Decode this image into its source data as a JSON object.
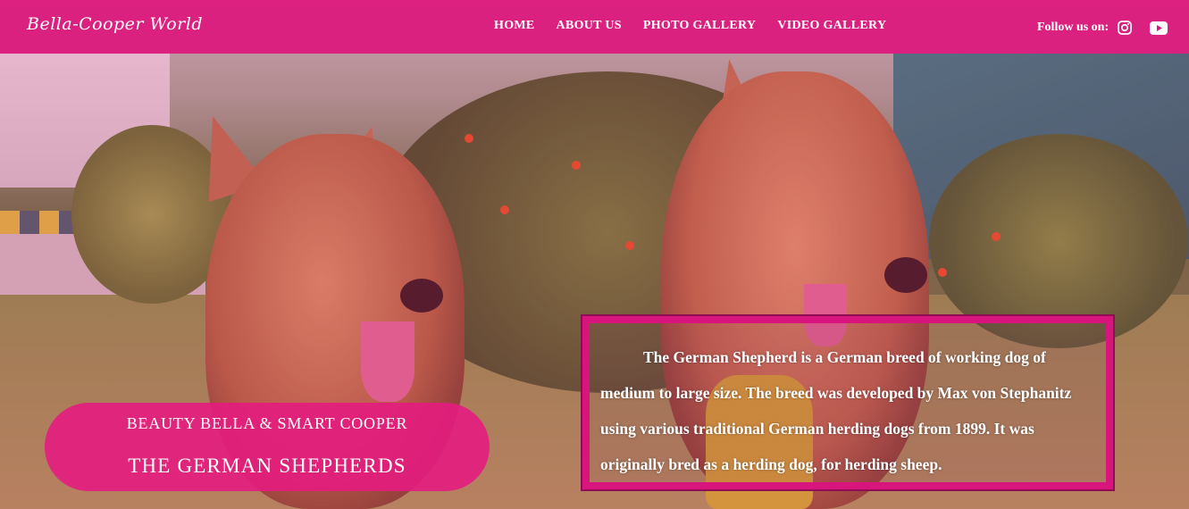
{
  "brand": {
    "name": "Bella-Cooper World"
  },
  "nav": {
    "items": [
      "HOME",
      "ABOUT US",
      "PHOTO GALLERY",
      "VIDEO GALLERY"
    ]
  },
  "social": {
    "label": "Follow us on:",
    "icons": [
      "instagram-icon",
      "youtube-icon"
    ]
  },
  "hero": {
    "image": "two-german-shepherds-photo",
    "tagline": "BEAUTY BELLA & SMART COOPER",
    "title": "THE GERMAN SHEPHERDS",
    "description": "The German Shepherd is a German breed of working dog of medium to large size. The breed was developed by Max von Stephanitz using various traditional German herding dogs from 1899. It was originally bred as a herding dog, for herding sheep."
  },
  "colors": {
    "accent": "#dd187d",
    "box_border": "#d8157d",
    "text": "#ffffff"
  }
}
